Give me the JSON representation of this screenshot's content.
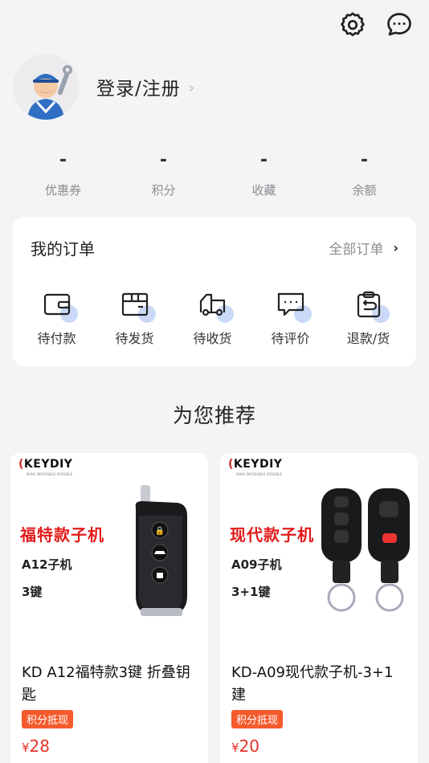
{
  "profile": {
    "login_label": "登录/注册"
  },
  "stats": [
    {
      "value": "-",
      "label": "优惠券"
    },
    {
      "value": "-",
      "label": "积分"
    },
    {
      "value": "-",
      "label": "收藏"
    },
    {
      "value": "-",
      "label": "余额"
    }
  ],
  "orders": {
    "title": "我的订单",
    "all_label": "全部订单",
    "items": [
      {
        "label": "待付款",
        "icon": "wallet-icon"
      },
      {
        "label": "待发货",
        "icon": "package-icon"
      },
      {
        "label": "待收货",
        "icon": "truck-icon"
      },
      {
        "label": "待评价",
        "icon": "comment-icon"
      },
      {
        "label": "退款/货",
        "icon": "refund-clipboard-icon"
      }
    ]
  },
  "recommend": {
    "title": "为您推荐"
  },
  "products": [
    {
      "brand": "KEYDIY",
      "brand_sub": "MAKE IMPOSSIBLE POSSIBLE",
      "promo_title": "福特款子机",
      "promo_line1": "A12子机",
      "promo_line2": "3键",
      "name": "KD A12福特款3键 折叠钥匙",
      "tag": "积分抵现",
      "currency": "¥",
      "price": "28"
    },
    {
      "brand": "KEYDIY",
      "brand_sub": "MAKE IMPOSSIBLE POSSIBLE",
      "promo_title": "现代款子机",
      "promo_line1": "A09子机",
      "promo_line2": "3+1键",
      "name": "KD-A09现代款子机-3+1建",
      "tag": "积分抵现",
      "currency": "¥",
      "price": "20"
    }
  ],
  "colors": {
    "accent_red": "#e8322a",
    "tag_orange": "#f55a2c",
    "icon_dot_blue": "#c9d9f7",
    "background": "#f4f4f6"
  }
}
